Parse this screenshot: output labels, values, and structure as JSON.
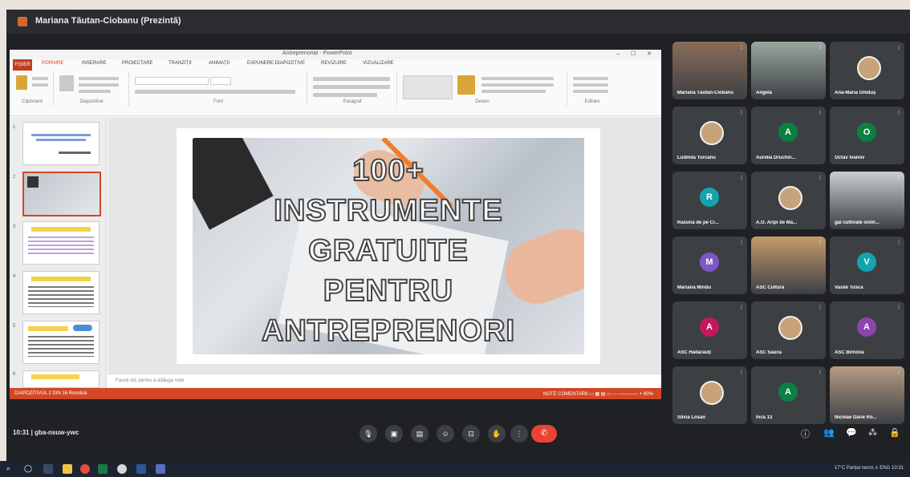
{
  "titlebar": {
    "title": "Mariana Tăutan-Ciobanu (Prezintă)"
  },
  "ppt": {
    "doc_title": "Antreprenoriat - PowerPoint",
    "window_ctrls": "– ☐ ✕",
    "tabs": [
      "FIȘIER",
      "PORNIRE",
      "INSERARE",
      "PROIECTARE",
      "TRANZIȚII",
      "ANIMAȚII",
      "EXPUNERE DIAPOZITIVE",
      "REVIZUIRE",
      "VIZUALIZARE"
    ],
    "ribbon_groups": [
      "Clipboard",
      "Diapozitive",
      "Font",
      "Paragraf",
      "Desen",
      "Editare"
    ],
    "slide_lines": [
      "100+",
      "INSTRUMENTE",
      "GRATUITE",
      "PENTRU",
      "ANTREPRENORI"
    ],
    "notes_placeholder": "Faceți clic pentru a adăuga note",
    "status_left": "DIAPOZITIVUL 2 DIN 16   Română",
    "status_right": "NOTE   COMENTARII   ▭ ▦ ▤ ▭ — ———— + 80%",
    "thumb_numbers": [
      "1",
      "2",
      "3",
      "4",
      "5",
      "6"
    ]
  },
  "participants": [
    {
      "name": "Mariana Tăutan-Ciobanu",
      "type": "video",
      "color": "#8a6d5a"
    },
    {
      "name": "Angela",
      "type": "video",
      "color": "#9aa7a0"
    },
    {
      "name": "Ana-Maria Ghiduș",
      "type": "photo"
    },
    {
      "name": "Ludmila Turcanu",
      "type": "photo"
    },
    {
      "name": "Aurelia Druchin...",
      "initial": "A",
      "color": "#0b8043"
    },
    {
      "name": "Octav Ivanov",
      "initial": "O",
      "color": "#0b8043"
    },
    {
      "name": "Răsună de pe Ci...",
      "initial": "R",
      "color": "#12a4af"
    },
    {
      "name": "A.O. Aripi de Ma...",
      "type": "photo"
    },
    {
      "name": "gal cultivate onlin...",
      "type": "video",
      "color": "#c9ced3"
    },
    {
      "name": "Mariana Mindu",
      "initial": "M",
      "color": "#7e57c2"
    },
    {
      "name": "ASC Cultură",
      "type": "video",
      "color": "#c49a6c"
    },
    {
      "name": "Vasile Tuscă",
      "initial": "V",
      "color": "#12a4af"
    },
    {
      "name": "ASC Hădărăuți",
      "initial": "A",
      "color": "#c2185b"
    },
    {
      "name": "ASC Sauca",
      "type": "photo"
    },
    {
      "name": "ASC Birnova",
      "initial": "A",
      "color": "#8e44ad"
    },
    {
      "name": "Silvia Losan",
      "type": "photo"
    },
    {
      "name": "Încă 13",
      "initial": "A",
      "color": "#0b8043"
    },
    {
      "name": "Nicolae Darie Ro...",
      "type": "video",
      "color": "#b59b84"
    }
  ],
  "bottom": {
    "time_meeting": "10:31  |  gba-nsuw-ywc",
    "end_icon": "✆"
  },
  "taskbar": {
    "tray_text": "17°C Parțial noros  ∧  ENG  10:31"
  },
  "colors": {
    "ppt_accent": "#d24726",
    "meet_bg": "#202124",
    "tile_bg": "#3c4043",
    "end_red": "#ea4335"
  }
}
